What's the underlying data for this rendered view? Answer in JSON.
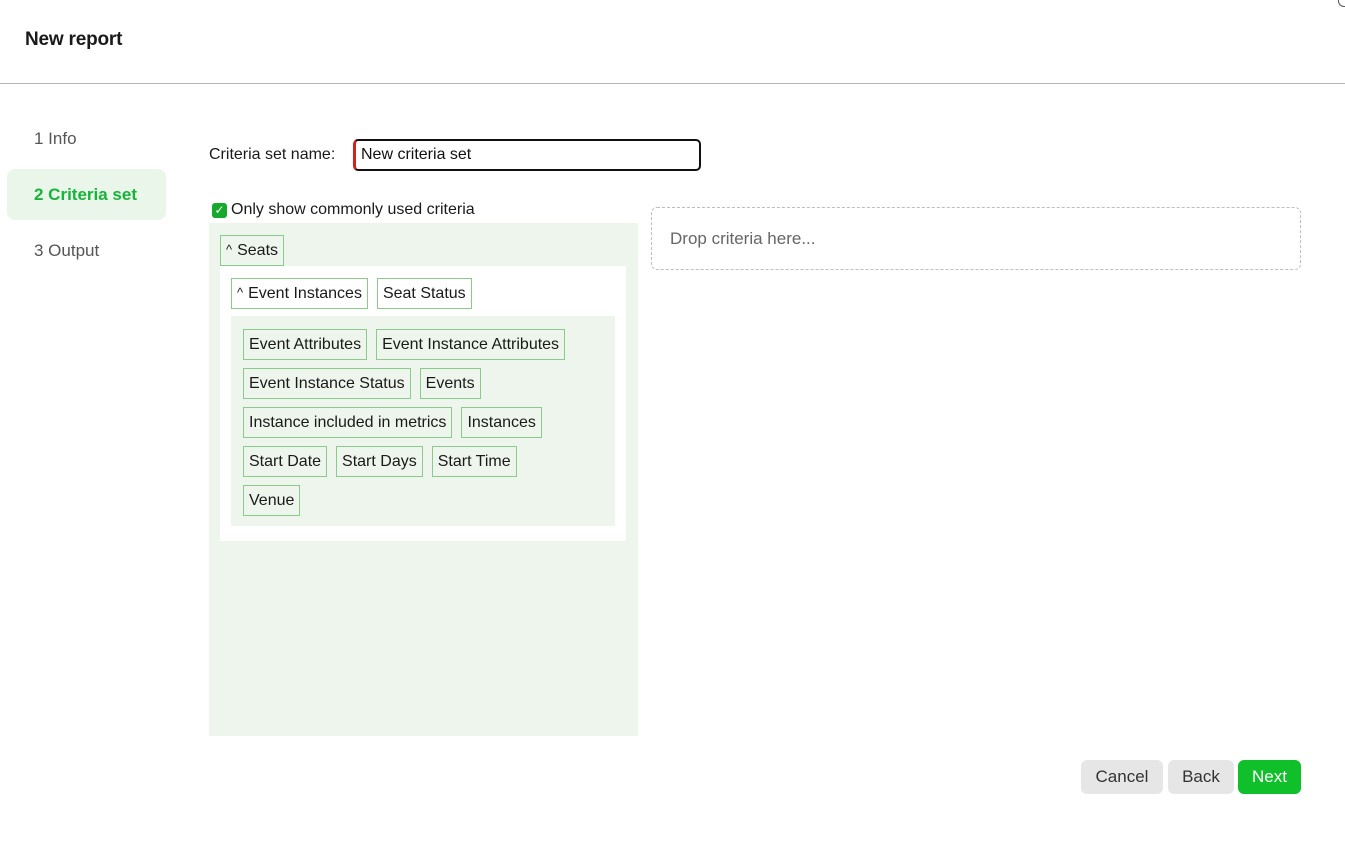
{
  "header": {
    "title": "New report"
  },
  "steps": [
    {
      "label": "1 Info",
      "active": false
    },
    {
      "label": "2 Criteria set",
      "active": true
    },
    {
      "label": "3 Output",
      "active": false
    }
  ],
  "criteria_name": {
    "label": "Criteria set name:",
    "value": "New criteria set"
  },
  "filter": {
    "label": "Only show commonly used criteria",
    "checked": true
  },
  "tree": {
    "root": {
      "label": "Seats",
      "expanded": true
    },
    "level2": [
      {
        "label": "Event Instances",
        "expanded": true
      },
      {
        "label": "Seat Status",
        "expanded": false
      }
    ],
    "leaves": [
      [
        "Event Attributes",
        "Event Instance Attributes"
      ],
      [
        "Event Instance Status",
        "Events"
      ],
      [
        "Instance included in metrics",
        "Instances"
      ],
      [
        "Start Date",
        "Start Days",
        "Start Time"
      ],
      [
        "Venue"
      ]
    ]
  },
  "dropzone": {
    "placeholder": "Drop criteria here..."
  },
  "buttons": {
    "cancel": "Cancel",
    "back": "Back",
    "next": "Next"
  },
  "colors": {
    "accent": "#17b33a",
    "next_button": "#10c02a",
    "invalid_marker": "#d32020",
    "tree_bg": "#eef5ec",
    "chip_border": "#8cc98c"
  },
  "icons": {
    "checkbox": "checkmark-icon",
    "expand": "chevron-up-icon"
  }
}
